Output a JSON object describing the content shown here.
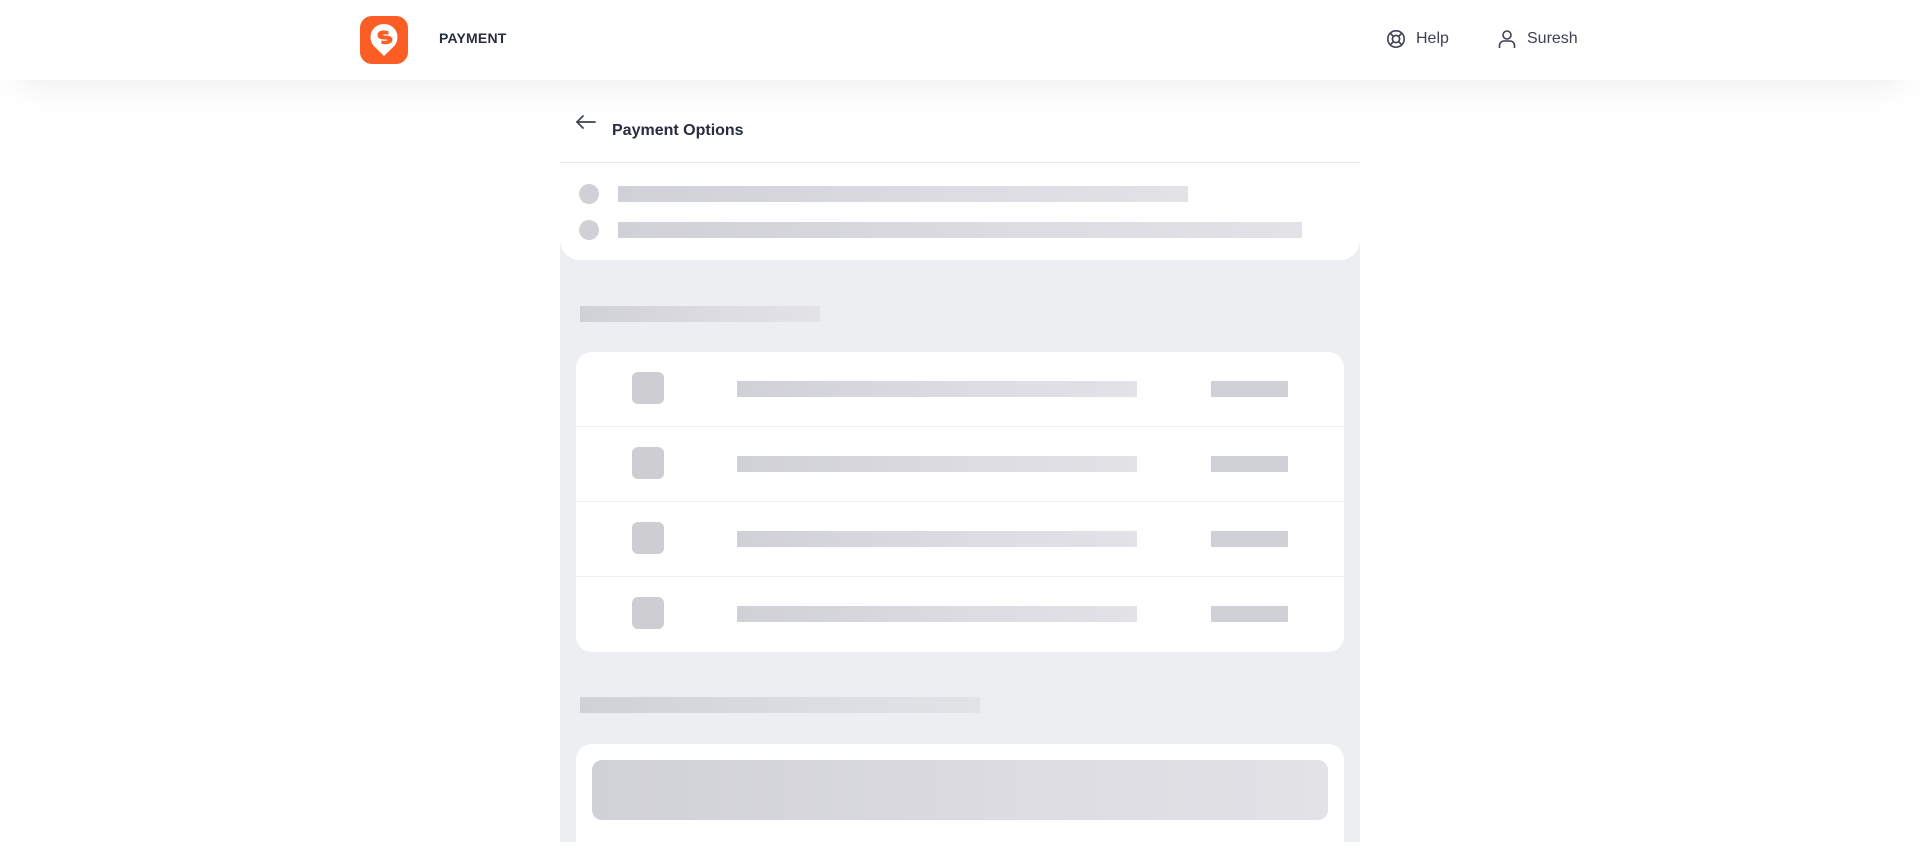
{
  "header": {
    "title": "PAYMENT",
    "logo_icon": "swiggy-logo-icon",
    "brand_color": "#fc5d24",
    "help_label": "Help",
    "help_icon": "lifebuoy-icon",
    "user_label": "Suresh",
    "user_icon": "user-icon"
  },
  "page": {
    "title": "Payment Options",
    "back_icon": "arrow-left-icon"
  },
  "skeleton": {
    "list_row_count": 4,
    "shimmer_color": "#d0d1d6",
    "background_color": "#edeef2"
  }
}
